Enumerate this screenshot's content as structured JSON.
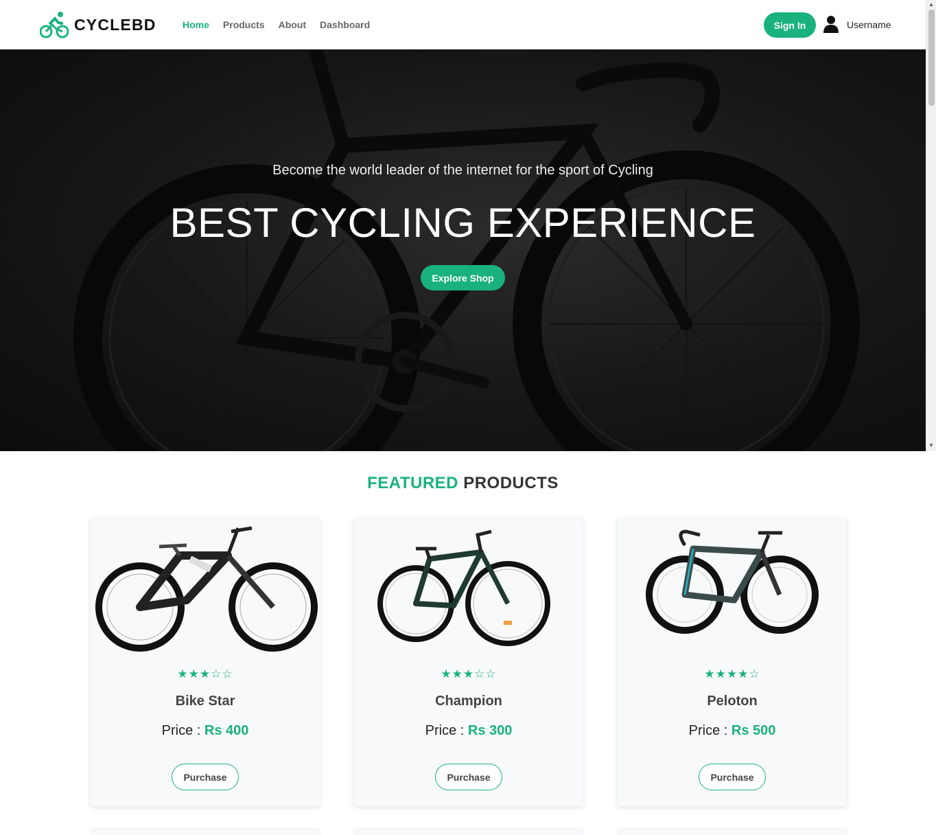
{
  "brand": {
    "name": "CYCLEBD",
    "accent_color": "#19b27c"
  },
  "nav": {
    "links": [
      {
        "label": "Home",
        "active": true
      },
      {
        "label": "Products",
        "active": false
      },
      {
        "label": "About",
        "active": false
      },
      {
        "label": "Dashboard",
        "active": false
      }
    ],
    "signin_label": "Sign In",
    "username": "Username",
    "user_icon": "user-icon"
  },
  "hero": {
    "subtitle": "Become the world leader of the internet for the sport of Cycling",
    "title": "BEST CYCLING EXPERIENCE",
    "cta_label": "Explore Shop"
  },
  "featured": {
    "title_accent": "FEATURED",
    "title_rest": "PRODUCTS",
    "products": [
      {
        "name": "Bike Star",
        "rating": 3,
        "stars": "★★★☆☆",
        "price_label": "Price : ",
        "price": "Rs 400",
        "button": "Purchase"
      },
      {
        "name": "Champion",
        "rating": 3,
        "stars": "★★★☆☆",
        "price_label": "Price : ",
        "price": "Rs 300",
        "button": "Purchase"
      },
      {
        "name": "Peloton",
        "rating": 4,
        "stars": "★★★★☆",
        "price_label": "Price : ",
        "price": "Rs 500",
        "button": "Purchase"
      }
    ]
  }
}
